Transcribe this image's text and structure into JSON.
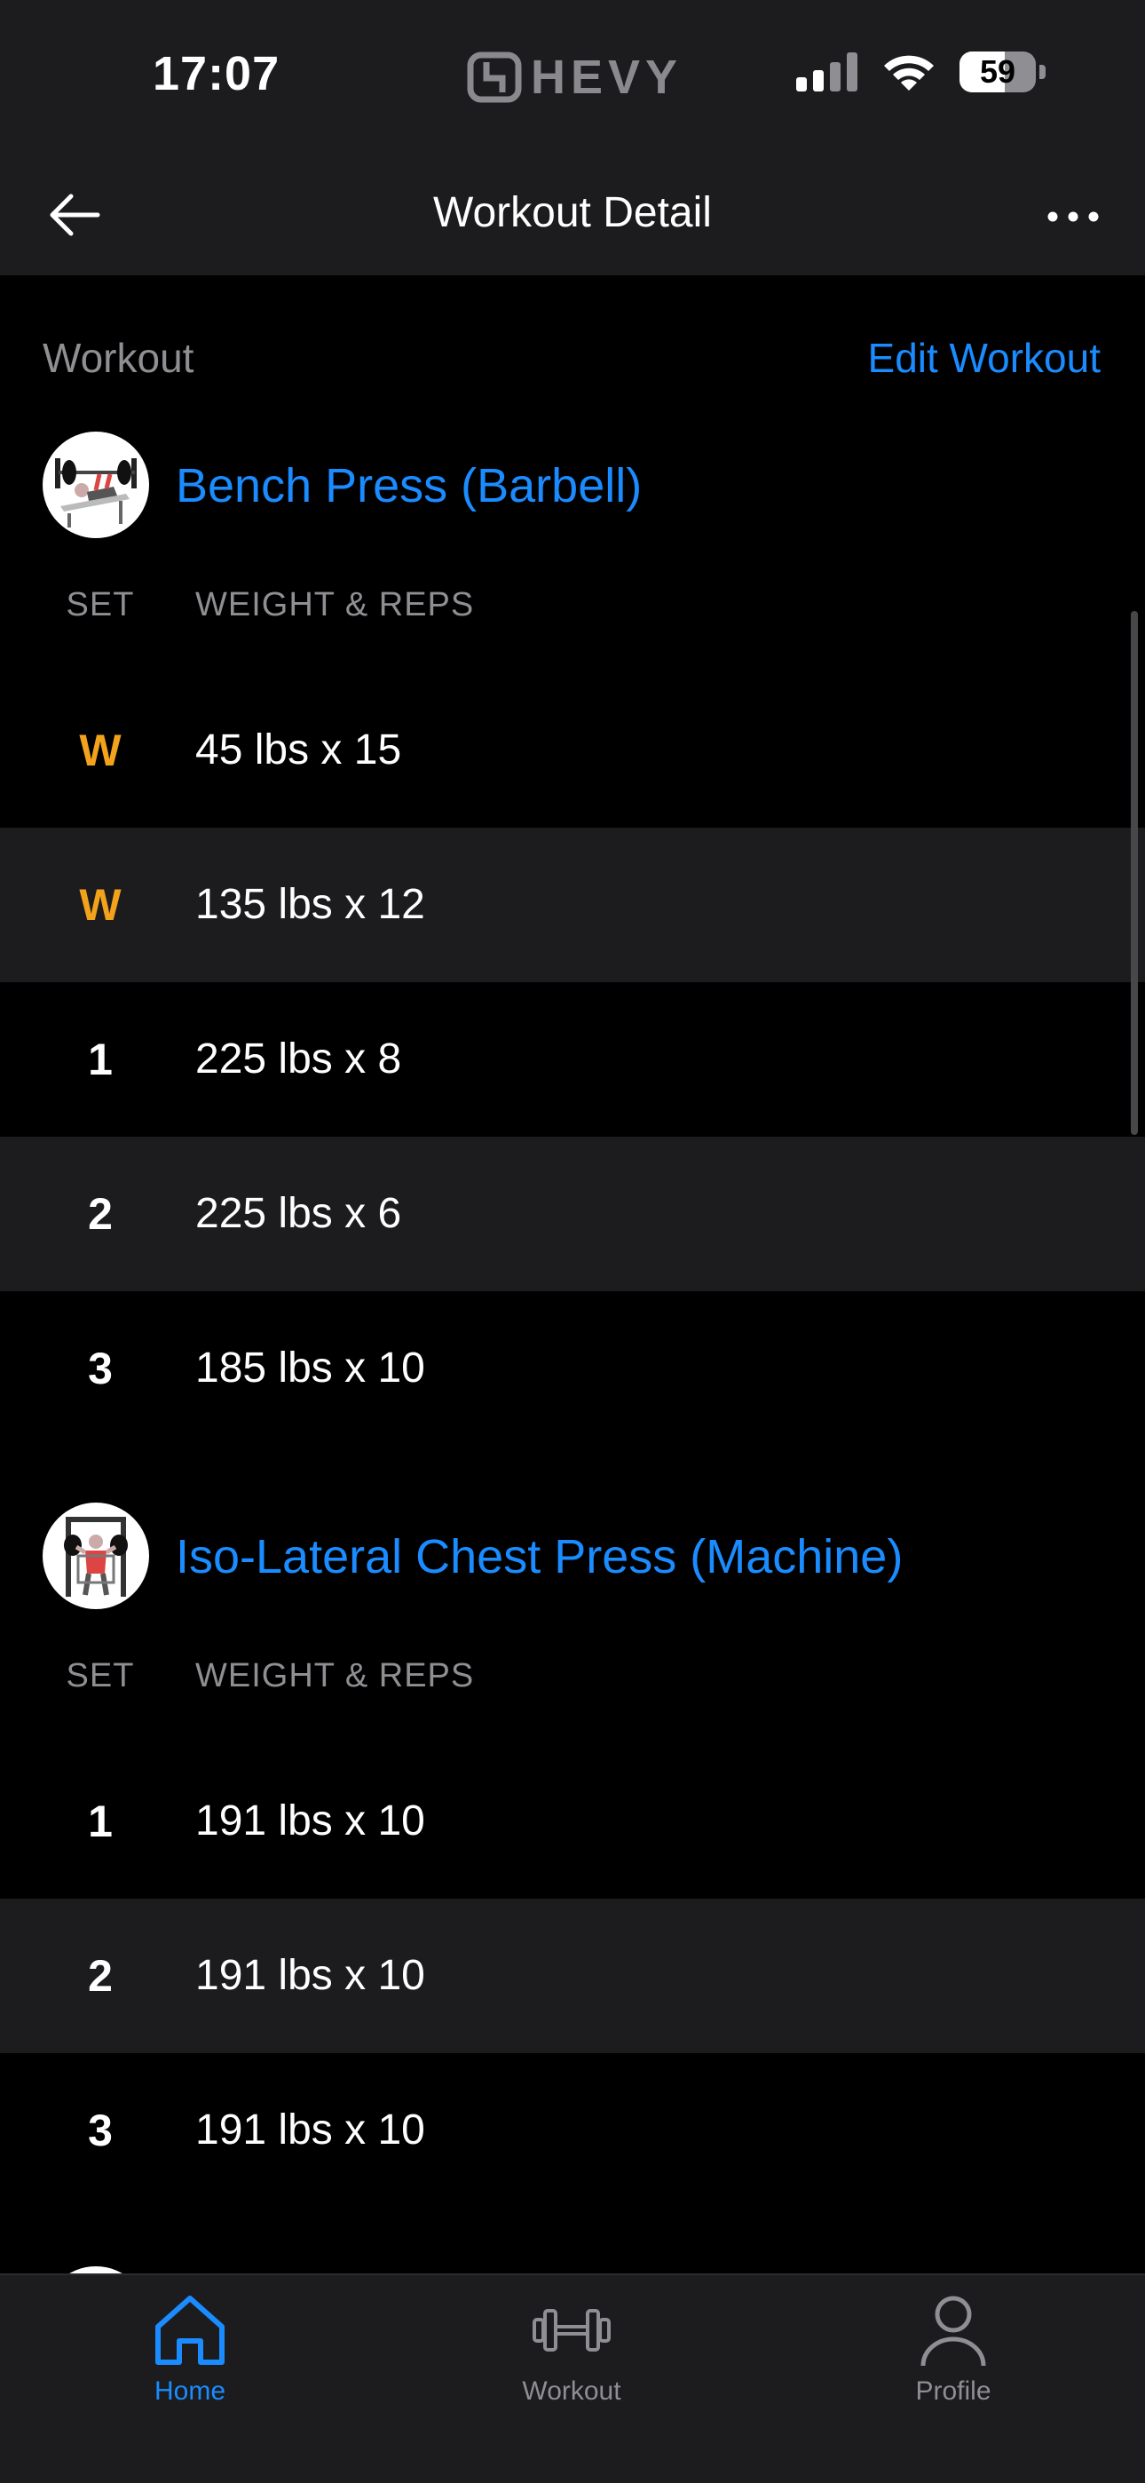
{
  "status_bar": {
    "time": "17:07",
    "brand": "HEVY",
    "battery": "59",
    "battery_level": 0.59
  },
  "header": {
    "title": "Workout Detail"
  },
  "section": {
    "label": "Workout",
    "edit_link": "Edit Workout"
  },
  "columns": {
    "set": "SET",
    "weight_reps": "WEIGHT & REPS"
  },
  "exercises": [
    {
      "name": "Bench Press (Barbell)",
      "sets": [
        {
          "set": "W",
          "value": "45 lbs x 15",
          "warmup": true
        },
        {
          "set": "W",
          "value": "135 lbs x 12",
          "warmup": true
        },
        {
          "set": "1",
          "value": "225 lbs x 8",
          "warmup": false
        },
        {
          "set": "2",
          "value": "225 lbs x 6",
          "warmup": false
        },
        {
          "set": "3",
          "value": "185 lbs x 10",
          "warmup": false
        }
      ]
    },
    {
      "name": "Iso-Lateral Chest Press (Machine)",
      "sets": [
        {
          "set": "1",
          "value": "191 lbs x 10",
          "warmup": false
        },
        {
          "set": "2",
          "value": "191 lbs x 10",
          "warmup": false
        },
        {
          "set": "3",
          "value": "191 lbs x 10",
          "warmup": false
        }
      ]
    }
  ],
  "tabbar": {
    "items": [
      {
        "label": "Home"
      },
      {
        "label": "Workout"
      },
      {
        "label": "Profile"
      }
    ]
  },
  "colors": {
    "accent": "#1a8cff",
    "warmup": "#f2a21b",
    "row_alt": "#1c1c1e"
  },
  "icons": [
    "back-arrow-icon",
    "more-icon",
    "signal-icon",
    "wifi-icon",
    "battery-icon",
    "home-icon",
    "dumbbell-icon",
    "person-icon",
    "hevy-logo-icon"
  ]
}
